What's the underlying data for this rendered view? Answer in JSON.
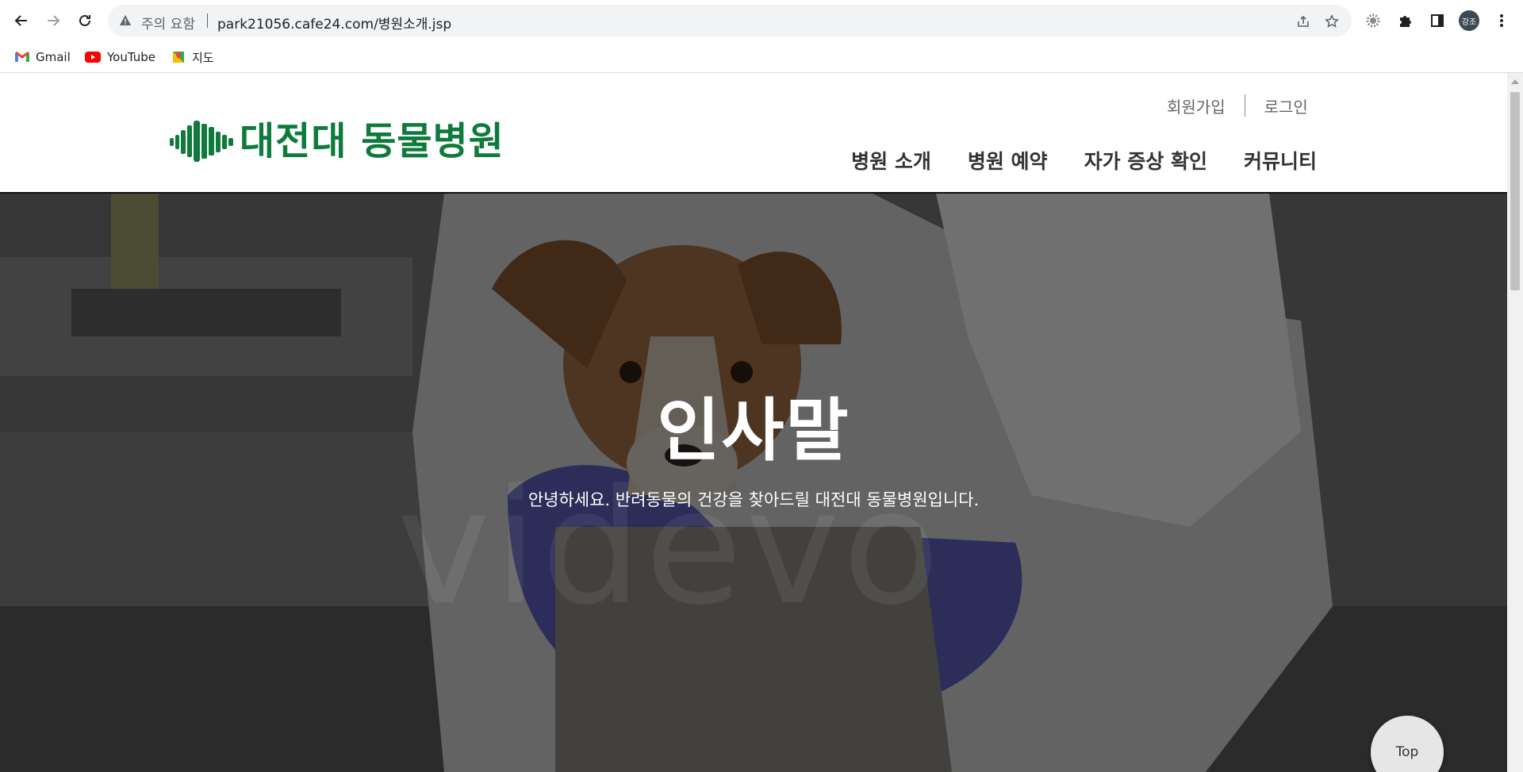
{
  "browser": {
    "security_label": "주의 요함",
    "url": "park21056.cafe24.com/병원소개.jsp",
    "profile_initials": "강조",
    "bookmarks": [
      {
        "label": "Gmail",
        "icon": "gmail-icon"
      },
      {
        "label": "YouTube",
        "icon": "youtube-icon"
      },
      {
        "label": "지도",
        "icon": "maps-icon"
      }
    ]
  },
  "header": {
    "logo_text": "대전대 동물병원",
    "util_links": {
      "signup": "회원가입",
      "login": "로그인"
    },
    "nav": [
      "병원 소개",
      "병원 예약",
      "자가 증상 확인",
      "커뮤니티"
    ]
  },
  "hero": {
    "title": "인사말",
    "subtitle": "안녕하세요. 반려동물의 건강을 찾아드릴 대전대 동물병원입니다.",
    "watermark": "videvo"
  },
  "top_button": "Top",
  "colors": {
    "brand_green": "#0e7a3c",
    "nav_text": "#333333"
  }
}
